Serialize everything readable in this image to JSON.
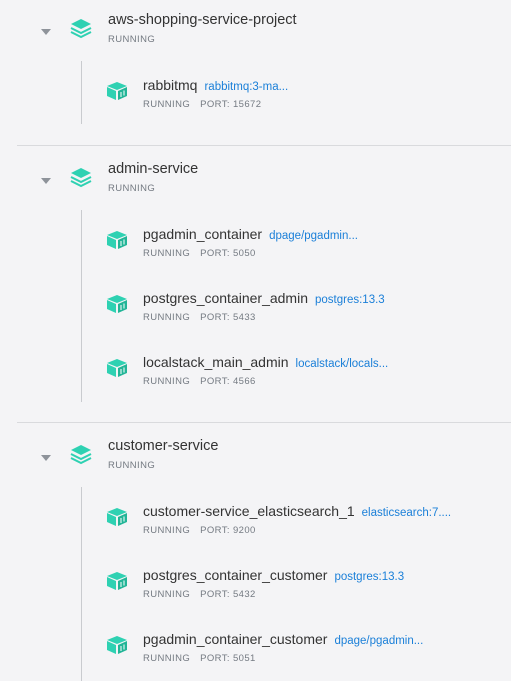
{
  "groups": [
    {
      "name": "aws-shopping-service-project",
      "status": "RUNNING",
      "containers": [
        {
          "name": "rabbitmq",
          "image": "rabbitmq:3-ma...",
          "status": "RUNNING",
          "port": "PORT: 15672"
        }
      ]
    },
    {
      "name": "admin-service",
      "status": "RUNNING",
      "containers": [
        {
          "name": "pgadmin_container",
          "image": "dpage/pgadmin...",
          "status": "RUNNING",
          "port": "PORT: 5050"
        },
        {
          "name": "postgres_container_admin",
          "image": "postgres:13.3",
          "status": "RUNNING",
          "port": "PORT: 5433"
        },
        {
          "name": "localstack_main_admin",
          "image": "localstack/locals...",
          "status": "RUNNING",
          "port": "PORT: 4566"
        }
      ]
    },
    {
      "name": "customer-service",
      "status": "RUNNING",
      "containers": [
        {
          "name": "customer-service_elasticsearch_1",
          "image": "elasticsearch:7....",
          "status": "RUNNING",
          "port": "PORT: 9200"
        },
        {
          "name": "postgres_container_customer",
          "image": "postgres:13.3",
          "status": "RUNNING",
          "port": "PORT: 5432"
        },
        {
          "name": "pgadmin_container_customer",
          "image": "dpage/pgadmin...",
          "status": "RUNNING",
          "port": "PORT: 5051"
        }
      ]
    }
  ],
  "colors": {
    "icon_teal": "#2ed1b2",
    "link_blue": "#1a7fd8",
    "background": "#f4f4f6"
  },
  "icons": {
    "group": "stack-layers-icon",
    "container": "container-box-icon",
    "toggle": "chevron-down-icon"
  }
}
